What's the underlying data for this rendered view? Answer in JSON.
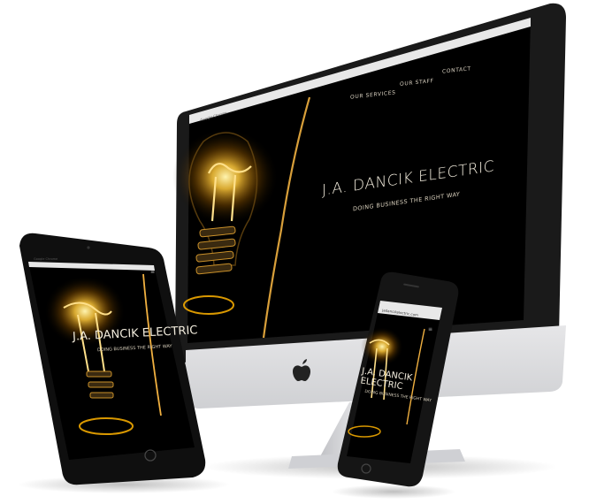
{
  "site": {
    "title": "J.A. DANCIK ELECTRIC",
    "tagline": "DOING BUSINESS THE RIGHT WAY",
    "nav": [
      "OUR SERVICES",
      "OUR STAFF",
      "CONTACT"
    ],
    "browser_tab": "Google Chrome",
    "phone_url": "jadancikelectric.com"
  },
  "devices": [
    "desktop-monitor",
    "tablet",
    "smartphone"
  ],
  "colors": {
    "screen_bg": "#000000",
    "filament": "#f2c94c",
    "glow": "#ffb300",
    "device_frame": "#121212",
    "monitor_stand": "#d9d9dc"
  },
  "icons": [
    "apple-logo-icon",
    "menu-icon",
    "home-button-icon"
  ]
}
